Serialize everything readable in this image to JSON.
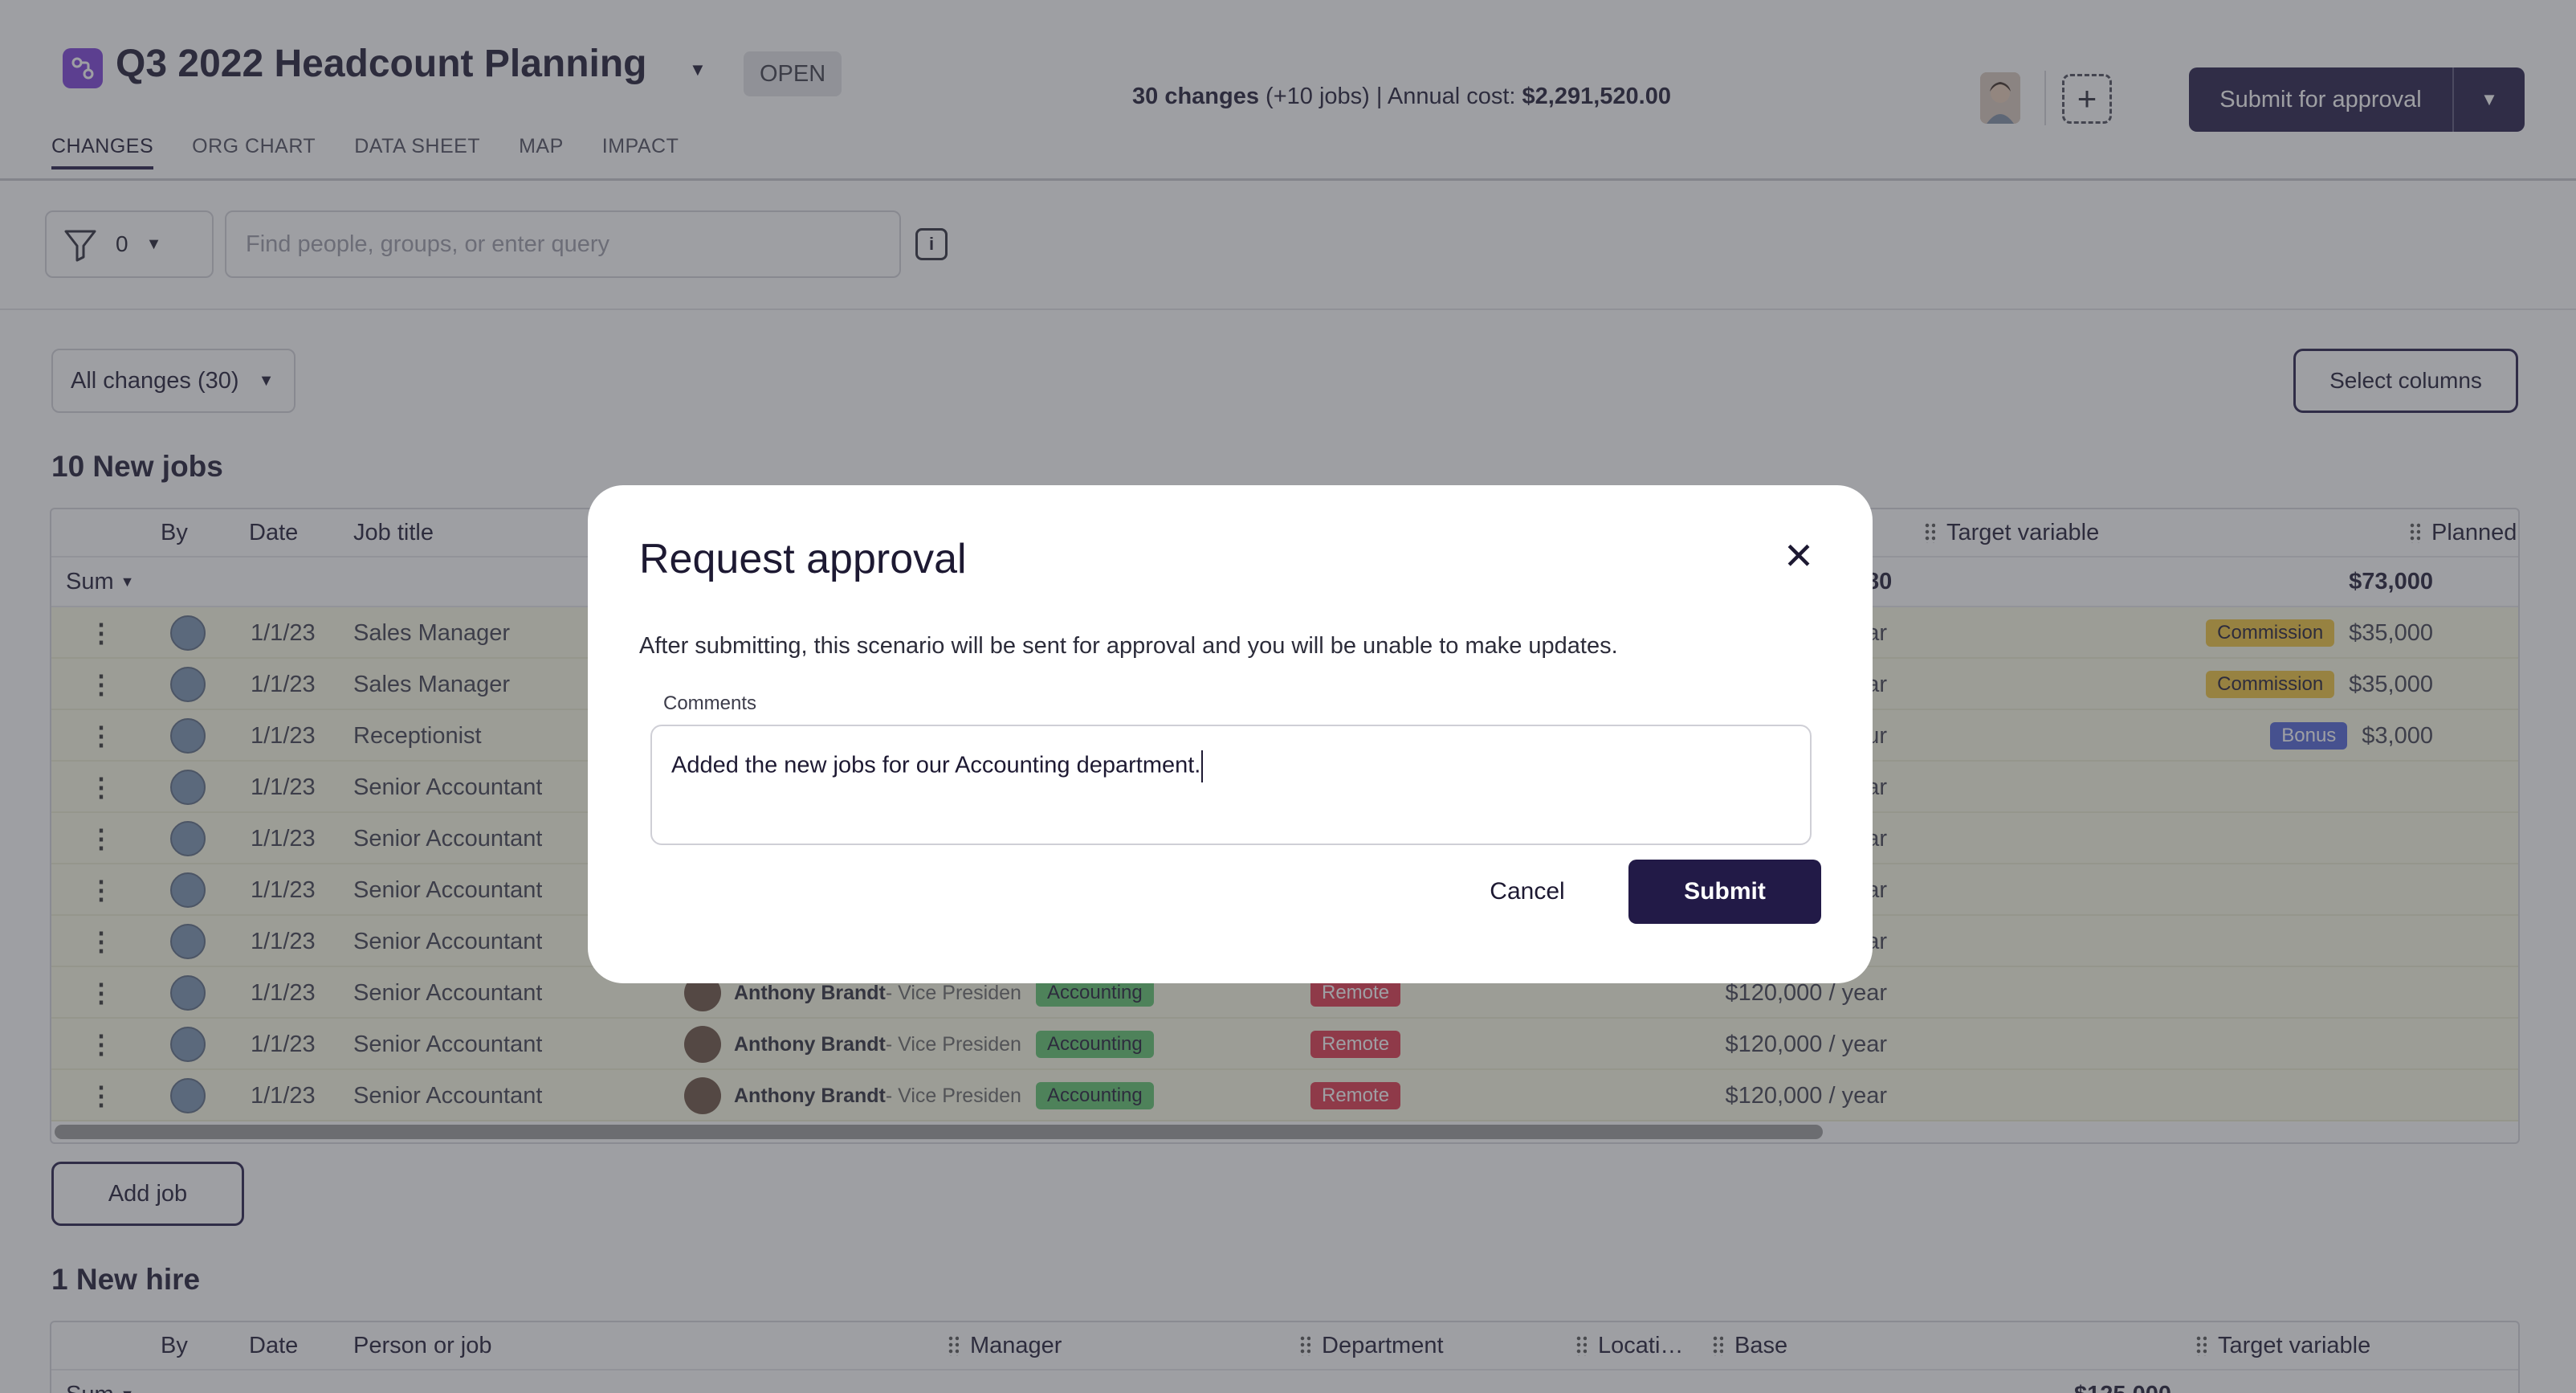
{
  "header": {
    "title": "Q3 2022 Headcount Planning",
    "status": "OPEN",
    "summary_changes": "30 changes",
    "summary_jobs": " (+10 jobs) | Annual cost: ",
    "summary_cost": "$2,291,520.00",
    "submit_label": "Submit for approval"
  },
  "tabs": [
    "CHANGES",
    "ORG CHART",
    "DATA SHEET",
    "MAP",
    "IMPACT"
  ],
  "filter": {
    "count": "0",
    "search_placeholder": "Find people, groups, or enter query"
  },
  "controls": {
    "all_changes": "All changes (30)",
    "select_columns": "Select columns"
  },
  "new_jobs": {
    "title": "10 New jobs",
    "columns": {
      "by": "By",
      "date": "Date",
      "job_title": "Job title",
      "target_variable": "Target variable",
      "planned": "Planned"
    },
    "sum_label": "Sum",
    "sum_base_partial": "80",
    "sum_target": "$73,000",
    "rows": [
      {
        "date": "1/1/23",
        "title": "Sales Manager",
        "base": "ear",
        "chip": "Commission",
        "target": "$35,000"
      },
      {
        "date": "1/1/23",
        "title": "Sales Manager",
        "base": "ear",
        "chip": "Commission",
        "target": "$35,000"
      },
      {
        "date": "1/1/23",
        "title": "Receptionist",
        "base": "our",
        "chip": "Bonus",
        "target": "$3,000"
      },
      {
        "date": "1/1/23",
        "title": "Senior Accountant",
        "base": "ear",
        "chip": "",
        "target": ""
      },
      {
        "date": "1/1/23",
        "title": "Senior Accountant",
        "base": "ear",
        "chip": "",
        "target": ""
      },
      {
        "date": "1/1/23",
        "title": "Senior Accountant",
        "base": "ear",
        "chip": "",
        "target": ""
      },
      {
        "date": "1/1/23",
        "title": "Senior Accountant",
        "base": "ear",
        "chip": "",
        "target": ""
      },
      {
        "date": "1/1/23",
        "title": "Senior Accountant",
        "manager": "Anthony Brandt",
        "manager_role": " - Vice Presiden",
        "dept": "Accounting",
        "loc": "Remote",
        "base": "$120,000 / year"
      },
      {
        "date": "1/1/23",
        "title": "Senior Accountant",
        "manager": "Anthony Brandt",
        "manager_role": " - Vice Presiden",
        "dept": "Accounting",
        "loc": "Remote",
        "base": "$120,000 / year"
      },
      {
        "date": "1/1/23",
        "title": "Senior Accountant",
        "manager": "Anthony Brandt",
        "manager_role": " - Vice Presiden",
        "dept": "Accounting",
        "loc": "Remote",
        "base": "$120,000 / year"
      }
    ],
    "add_label": "Add job"
  },
  "new_hire": {
    "title": "1 New hire",
    "columns": {
      "by": "By",
      "date": "Date",
      "person": "Person or job",
      "manager": "Manager",
      "department": "Department",
      "location": "Locati…",
      "base": "Base",
      "target_variable": "Target variable"
    },
    "sum_label": "Sum",
    "sum_base": "$125,000"
  },
  "modal": {
    "title": "Request approval",
    "description": "After submitting, this scenario will be sent for approval and you will be unable to make updates.",
    "comments_label": "Comments",
    "comments_value": "Added the new jobs for our Accounting department.",
    "cancel": "Cancel",
    "submit": "Submit"
  }
}
